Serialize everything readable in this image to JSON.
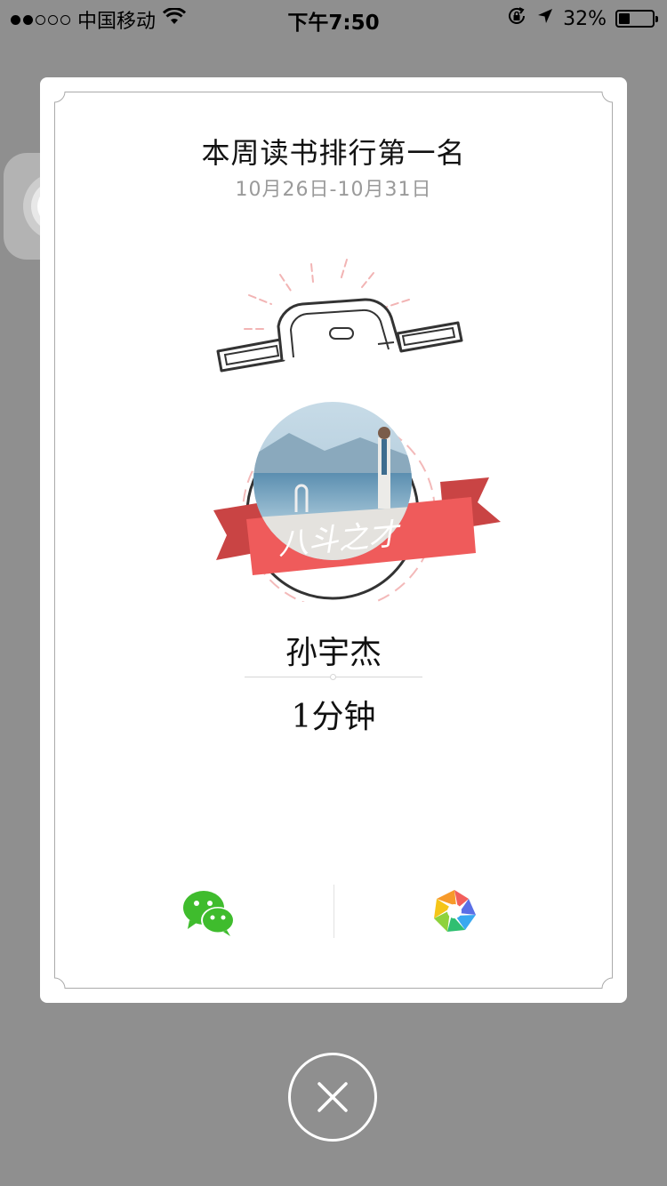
{
  "status_bar": {
    "carrier": "中国移动",
    "signal_dots_filled": 2,
    "signal_dots_total": 5,
    "time": "下午7:50",
    "battery_percent": "32%",
    "battery_level": 0.32,
    "icons": [
      "wifi-icon",
      "rotation-lock-icon",
      "location-arrow-icon",
      "battery-icon"
    ]
  },
  "card": {
    "title": "本周读书排行第一名",
    "date_range": "10月26日-10月31日",
    "badge": {
      "ribbon_text": "八斗之才",
      "ribbon_color": "#ef5b5b",
      "ribbon_dark_color": "#c94444",
      "photo_desc_icon": "avatar"
    },
    "user_name": "孙宇杰",
    "reading_time": "1分钟",
    "share": {
      "wechat_icon": "wechat-icon",
      "wechat_color": "#3fbc2d",
      "moments_icon": "moments-icon"
    }
  },
  "close_icon": "close-icon"
}
